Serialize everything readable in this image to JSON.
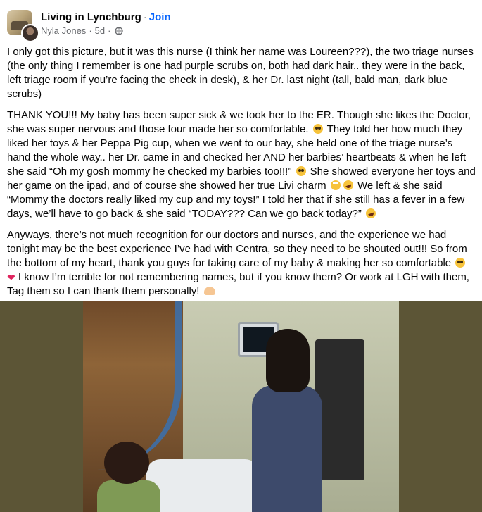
{
  "post": {
    "group_name": "Living in Lynchburg",
    "separator": "·",
    "join_label": "Join",
    "author": "Nyla Jones",
    "time": "5d",
    "dot": "·",
    "p1": "I only got this picture, but it was this nurse (I think her name was Loureen???), the two triage nurses (the only thing I remember is one had purple scrubs on, both had dark hair.. they were in the back, left triage room if you’re facing the check in desk), & her Dr. last night (tall, bald man, dark blue scrubs)",
    "p2a": "THANK YOU!!! My baby has been super sick & we took her to the ER. Though she likes the Doctor, she was super nervous and those four made her so comfortable.",
    "p2b": " They told her how much they liked her toys & her Peppa Pig cup, when we went to our bay, she held one of the triage nurse’s hand the whole way.. her Dr. came in and checked her AND her barbies’ heartbeats & when he left she said “Oh my gosh mommy he checked my barbies too!!!”",
    "p2c": " She showed everyone her toys and her game on the ipad, and of course she showed her true Livi charm",
    "p2d": " We left & she said “Mommy the doctors really liked my cup and my toys!” I told her that if she still has a fever in a few days, we’ll have to go back & she said “TODAY??? Can we go back today?”",
    "p3a": "Anyways, there’s not much recognition for our doctors and nurses, and the experience we had tonight may be the best experience I’ve had with Centra, so they need to be shouted out!!! So from the bottom of my heart, thank you guys for taking care of my baby & making her so comfortable",
    "p3b": " I know I’m terrible for not remembering names, but if you know them? Or work at LGH with them, Tag them so I can thank them personally!",
    "heart": "❤"
  },
  "colors": {
    "link": "#0866ff",
    "meta": "#65676b",
    "text": "#050505"
  },
  "icons": [
    "globe-icon",
    "flushed-face-emoji",
    "rolling-eyes-emoji",
    "laughing-emoji",
    "red-heart-emoji",
    "heart-hands-emoji"
  ]
}
